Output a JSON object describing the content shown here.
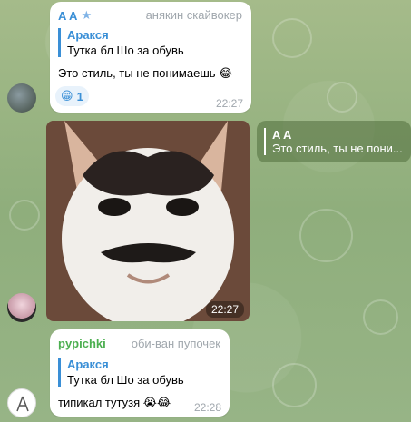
{
  "messages": [
    {
      "sender": "A A",
      "rank": "анякин скайвокер",
      "reply": {
        "name": "Аракся",
        "text": "Тутка бл  Шо за обувь"
      },
      "text": "Это стиль, ты не понимаешь",
      "emoji": "😂",
      "reaction": {
        "emoji": "😁",
        "count": "1"
      },
      "time": "22:27"
    },
    {
      "reply": {
        "name": "A A",
        "text": "Это стиль, ты не пони..."
      },
      "time": "22:27"
    },
    {
      "sender": "pypichki",
      "rank": "оби-ван пупочек",
      "reply": {
        "name": "Аракся",
        "text": "Тутка бл  Шо за обувь"
      },
      "text": "типикал тутузя",
      "emoji": "😭😂",
      "time": "22:28"
    }
  ],
  "colors": {
    "sender1": "#3a8fd6",
    "sender2": "#4caf50",
    "accent": "#3a8fd6"
  },
  "icons": {
    "star": "star-icon"
  }
}
